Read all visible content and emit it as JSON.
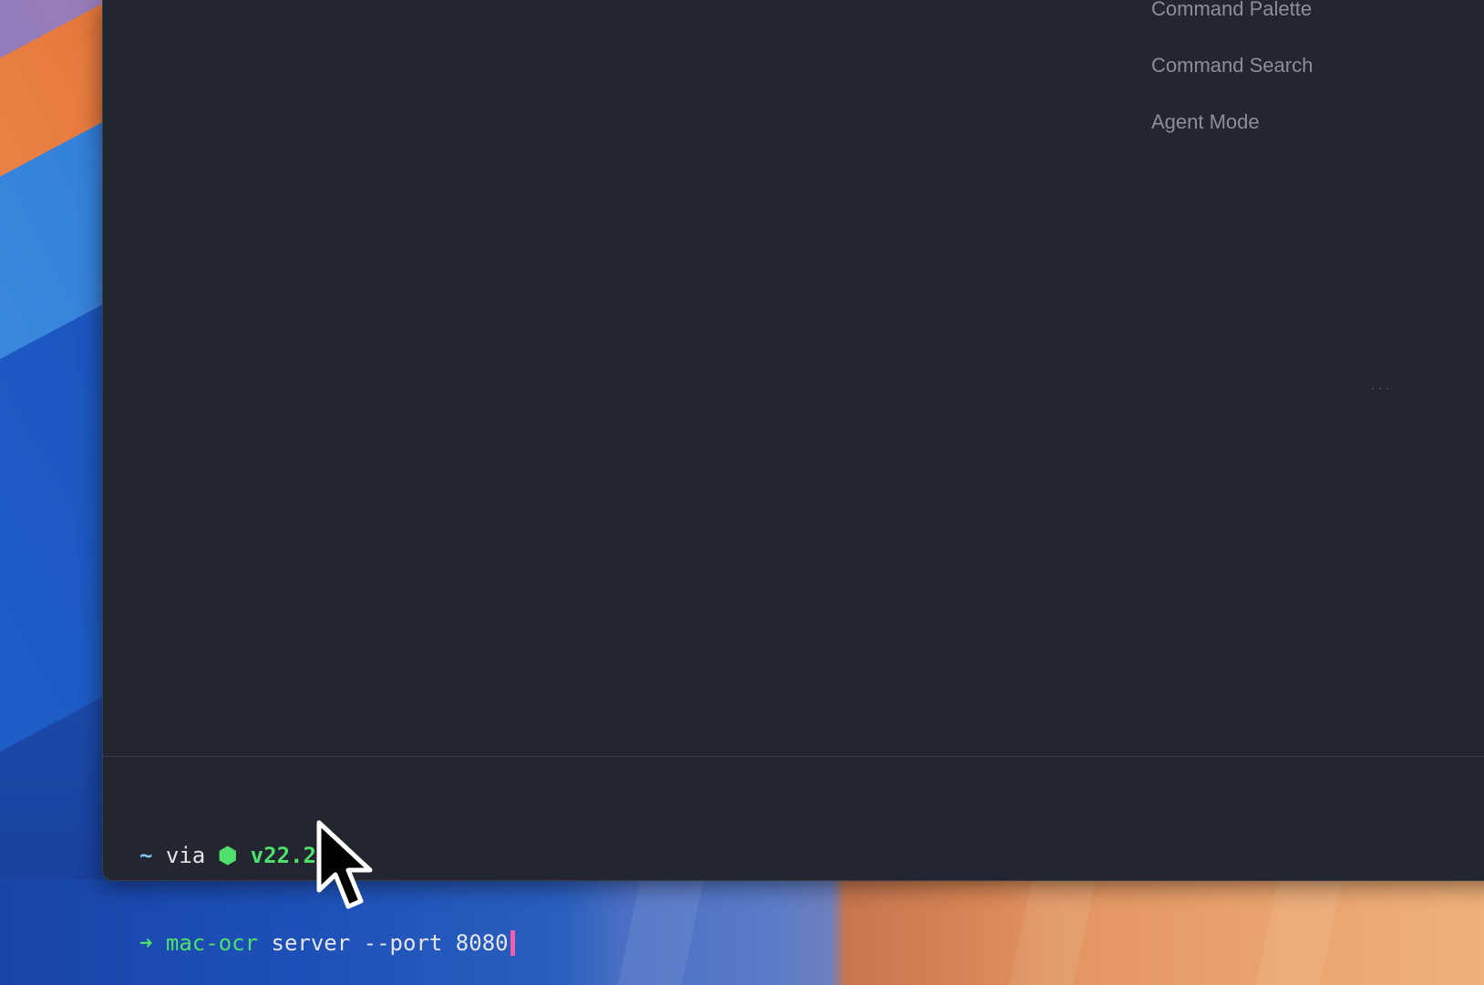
{
  "menu": {
    "items": [
      {
        "label": "Command Palette"
      },
      {
        "label": "Command Search"
      },
      {
        "label": "Agent Mode"
      }
    ],
    "more": "···"
  },
  "prompt": {
    "dir": "~",
    "via": "via",
    "node_icon": "nodejs-icon",
    "node_glyph": "⬢",
    "version": "v22.2.0",
    "arrow": "➜",
    "command": "mac-ocr",
    "args": " server --port 8080"
  },
  "colors": {
    "background": "#232530",
    "accent_green": "#4ee06a",
    "tilde_blue": "#7cc4f0",
    "cursor_pink": "#f25fa8",
    "menu_text": "#8b8e9a"
  }
}
